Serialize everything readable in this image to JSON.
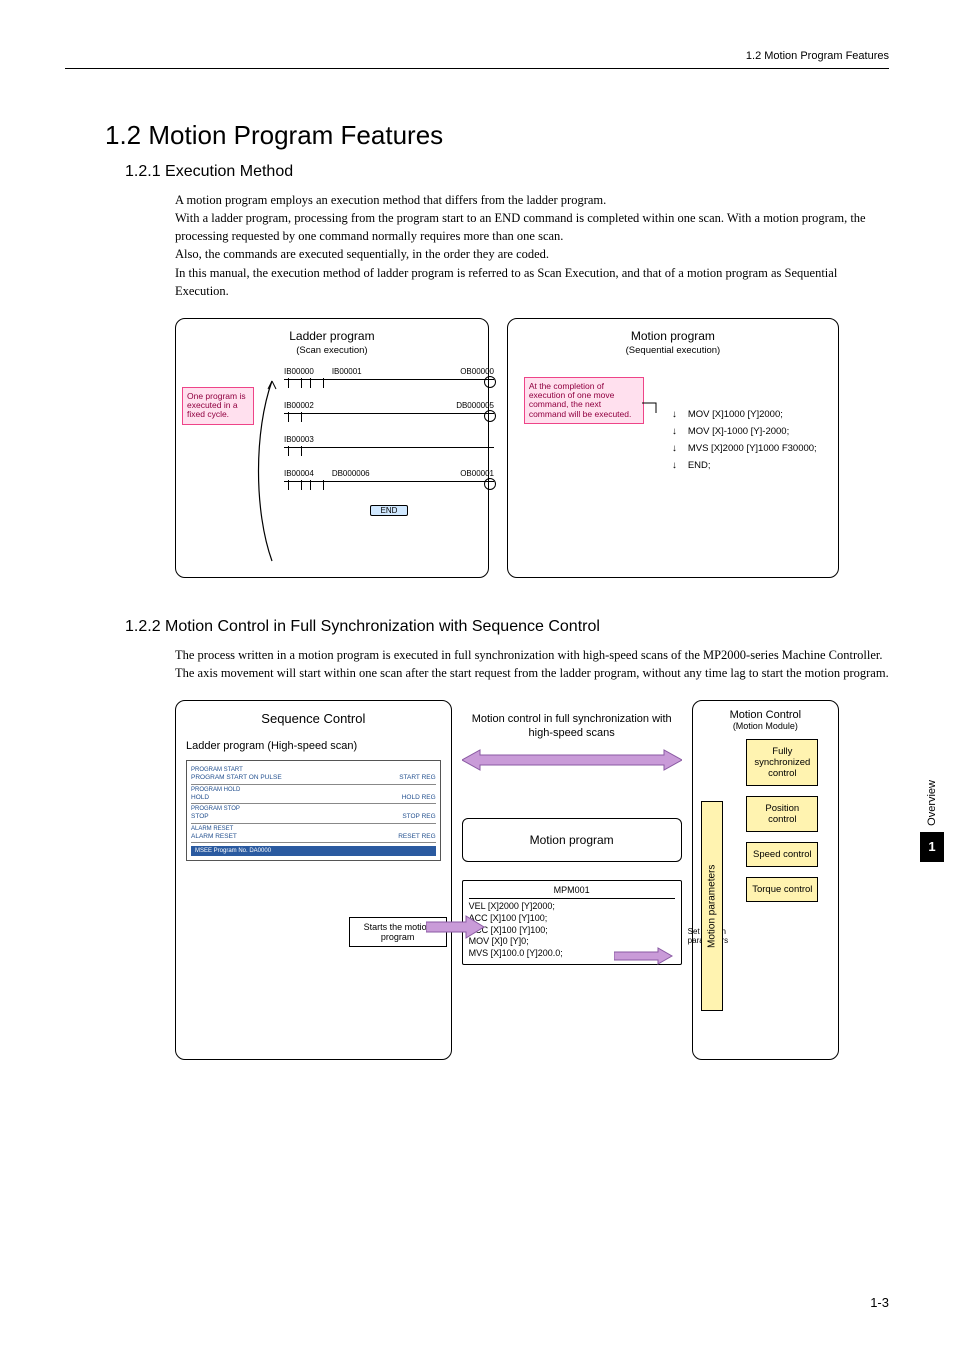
{
  "header": {
    "breadcrumb": "1.2  Motion Program Features"
  },
  "h1": "1.2  Motion Program Features",
  "s1": {
    "title": "1.2.1  Execution Method",
    "para": "A motion program employs an execution method that differs from the ladder program.\nWith a ladder program, processing from the program start to an END command is completed within one scan. With a motion program, the processing requested by one command normally requires more than one scan.\nAlso, the commands are executed sequentially, in the order they are coded.\nIn this manual, the execution method of ladder program is referred to as Scan Execution, and that of a motion program as Sequential Execution."
  },
  "d1": {
    "left": {
      "title": "Ladder program",
      "sub": "(Scan execution)",
      "pink": "One program is executed in a fixed cycle.",
      "rungs": [
        {
          "in": [
            "IB00000",
            "IB00001"
          ],
          "out": "OB00000"
        },
        {
          "in": [
            "IB00002"
          ],
          "out": "DB000005"
        },
        {
          "in": [
            "IB00003"
          ],
          "out": ""
        },
        {
          "in": [
            "IB00004",
            "DB000006"
          ],
          "out": "OB00001"
        }
      ],
      "end": "END"
    },
    "right": {
      "title": "Motion program",
      "sub": "(Sequential execution)",
      "pink": "At the completion of execution of one move command, the next command will be executed.",
      "lines": [
        "MOV [X]1000 [Y]2000;",
        "MOV [X]-1000 [Y]-2000;",
        "MVS [X]2000 [Y]1000 F30000;",
        "END;"
      ]
    }
  },
  "s2": {
    "title": "1.2.2  Motion Control in Full Synchronization with Sequence Control",
    "para": "The process written in a motion program is executed in full synchronization with high-speed scans of the MP2000-series Machine Controller. The axis movement will start within one scan after the start request from the ladder program, without any time lag to start the motion program."
  },
  "d2": {
    "left": {
      "title": "Sequence Control",
      "sub": "Ladder program (High-speed scan)",
      "mini": [
        {
          "h": "PROGRAM START",
          "l": "PROGRAM START   ON PULSE",
          "r": "START REG"
        },
        {
          "h": "PROGRAM HOLD",
          "l": "HOLD",
          "r": "HOLD REG"
        },
        {
          "h": "PROGRAM STOP",
          "l": "STOP",
          "r": "STOP REG"
        },
        {
          "h": "ALARM RESET",
          "l": "ALARM RESET",
          "r": "RESET REG"
        }
      ],
      "starts": "Starts the motion program"
    },
    "mid": {
      "title": "Motion control in full synchronization with high-speed scans",
      "box": "Motion program",
      "code_head": "MPM001",
      "code": [
        "VEL [X]2000 [Y]2000;",
        "ACC [X]100 [Y]100;",
        "DCC [X]100 [Y]100;",
        "MOV [X]0 [Y]0;",
        "MVS [X]100.0 [Y]200.0;"
      ],
      "set": "Set motion parameters"
    },
    "right": {
      "title": "Motion Control",
      "sub": "(Motion Module)",
      "bar": "Motion parameters",
      "items": [
        "Fully synchronized control",
        "Position control",
        "Speed control",
        "Torque control"
      ]
    }
  },
  "side": {
    "label": "Overview",
    "num": "1"
  },
  "page": "1-3"
}
